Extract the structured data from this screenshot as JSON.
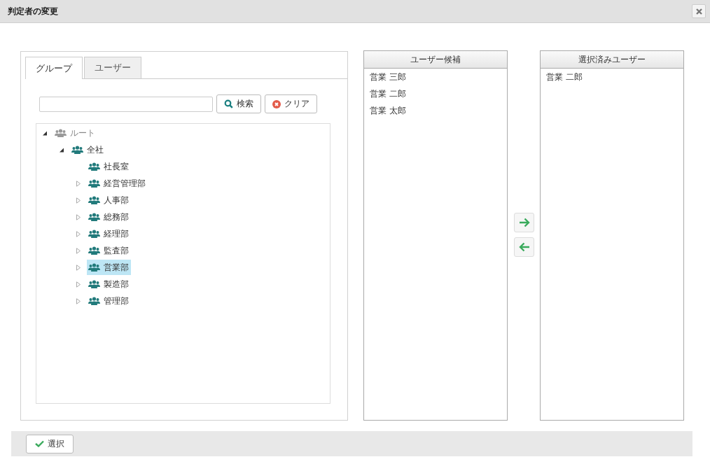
{
  "window": {
    "title": "判定者の変更"
  },
  "tabs": [
    {
      "label": "グループ",
      "selected": true
    },
    {
      "label": "ユーザー",
      "selected": false
    }
  ],
  "search": {
    "search_button": "検索",
    "clear_button": "クリア"
  },
  "tree": [
    {
      "label": "ルート",
      "kind": "folder",
      "expanded": true,
      "disabled": true,
      "selected": false,
      "children": [
        {
          "label": "全社",
          "kind": "folder",
          "expanded": true,
          "disabled": false,
          "selected": false,
          "children": [
            {
              "label": "社長室",
              "kind": "leaf",
              "disabled": false,
              "selected": false
            },
            {
              "label": "経営管理部",
              "kind": "folder",
              "expanded": false,
              "disabled": false,
              "selected": false
            },
            {
              "label": "人事部",
              "kind": "folder",
              "expanded": false,
              "disabled": false,
              "selected": false
            },
            {
              "label": "総務部",
              "kind": "folder",
              "expanded": false,
              "disabled": false,
              "selected": false
            },
            {
              "label": "経理部",
              "kind": "folder",
              "expanded": false,
              "disabled": false,
              "selected": false
            },
            {
              "label": "監査部",
              "kind": "folder",
              "expanded": false,
              "disabled": false,
              "selected": false
            },
            {
              "label": "営業部",
              "kind": "folder",
              "expanded": false,
              "disabled": false,
              "selected": true
            },
            {
              "label": "製造部",
              "kind": "folder",
              "expanded": false,
              "disabled": false,
              "selected": false
            },
            {
              "label": "管理部",
              "kind": "folder",
              "expanded": false,
              "disabled": false,
              "selected": false
            }
          ]
        }
      ]
    }
  ],
  "candidates": {
    "header": "ユーザー候補",
    "items": [
      "営業 三郎",
      "営業 二郎",
      "営業 太郎"
    ]
  },
  "selected_users": {
    "header": "選択済みユーザー",
    "items": [
      "営業 二郎"
    ]
  },
  "footer": {
    "select_button": "選択"
  }
}
